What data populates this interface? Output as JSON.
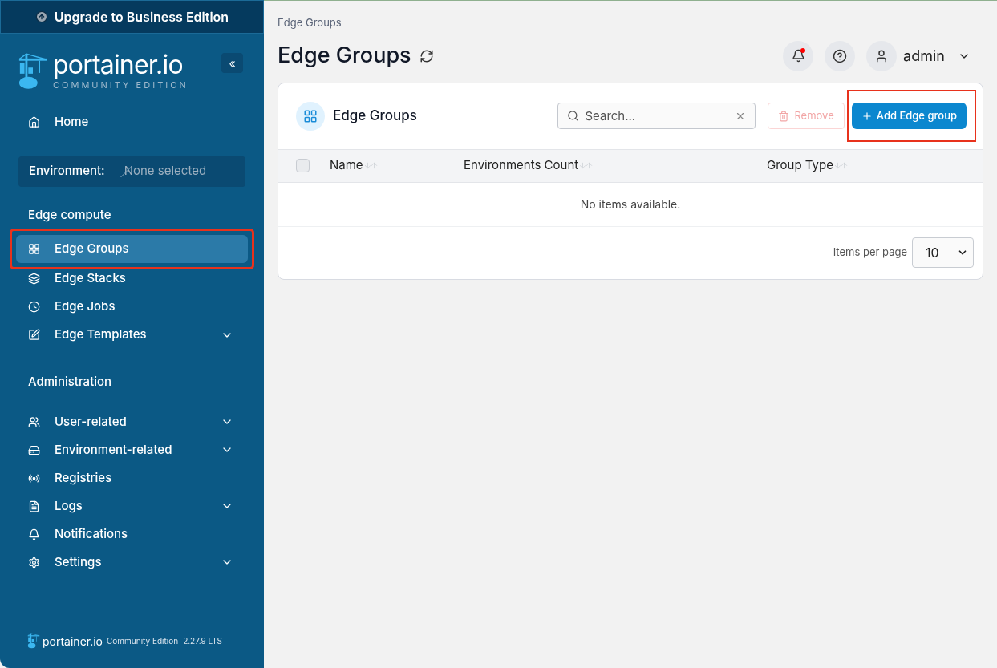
{
  "upgrade_banner": {
    "label": "Upgrade to Business Edition"
  },
  "logo": {
    "name": "portainer.io",
    "edition": "COMMUNITY EDITION"
  },
  "sidebar": {
    "collapse_button": {
      "label": "«"
    },
    "home": {
      "label": "Home",
      "selected": false,
      "highlighted": false,
      "expandable": false
    },
    "environment": {
      "label": "Environment:",
      "value": "None selected"
    },
    "sections": [
      {
        "title": "Edge compute",
        "items": [
          {
            "label": "Edge Groups",
            "selected": true,
            "highlighted": true,
            "expandable": false
          },
          {
            "label": "Edge Stacks",
            "selected": false,
            "highlighted": false,
            "expandable": false
          },
          {
            "label": "Edge Jobs",
            "selected": false,
            "highlighted": false,
            "expandable": false
          },
          {
            "label": "Edge Templates",
            "selected": false,
            "highlighted": false,
            "expandable": true
          }
        ]
      },
      {
        "title": "Administration",
        "items": [
          {
            "label": "User-related",
            "selected": false,
            "highlighted": false,
            "expandable": true
          },
          {
            "label": "Environment-related",
            "selected": false,
            "highlighted": false,
            "expandable": true
          },
          {
            "label": "Registries",
            "selected": false,
            "highlighted": false,
            "expandable": false
          },
          {
            "label": "Logs",
            "selected": false,
            "highlighted": false,
            "expandable": true
          },
          {
            "label": "Notifications",
            "selected": false,
            "highlighted": false,
            "expandable": false
          },
          {
            "label": "Settings",
            "selected": false,
            "highlighted": false,
            "expandable": true
          }
        ]
      }
    ]
  },
  "footer": {
    "name": "portainer.io",
    "edition": "Community Edition",
    "version": "2.27.9 LTS"
  },
  "header": {
    "breadcrumb": "Edge Groups",
    "title": "Edge Groups",
    "unread_notifications": true,
    "user": "admin"
  },
  "card": {
    "title": "Edge Groups",
    "search": {
      "placeholder": "Search..."
    },
    "remove_button": {
      "label": "Remove",
      "disabled": true
    },
    "add_button": {
      "label": "Add Edge group",
      "highlighted": true
    },
    "table": {
      "select_all": {
        "checked": false
      },
      "columns": [
        "Name",
        "Environments Count",
        "Group Type"
      ],
      "empty_message": "No items available."
    },
    "pagination": {
      "label": "Items per page",
      "value": "10"
    }
  }
}
